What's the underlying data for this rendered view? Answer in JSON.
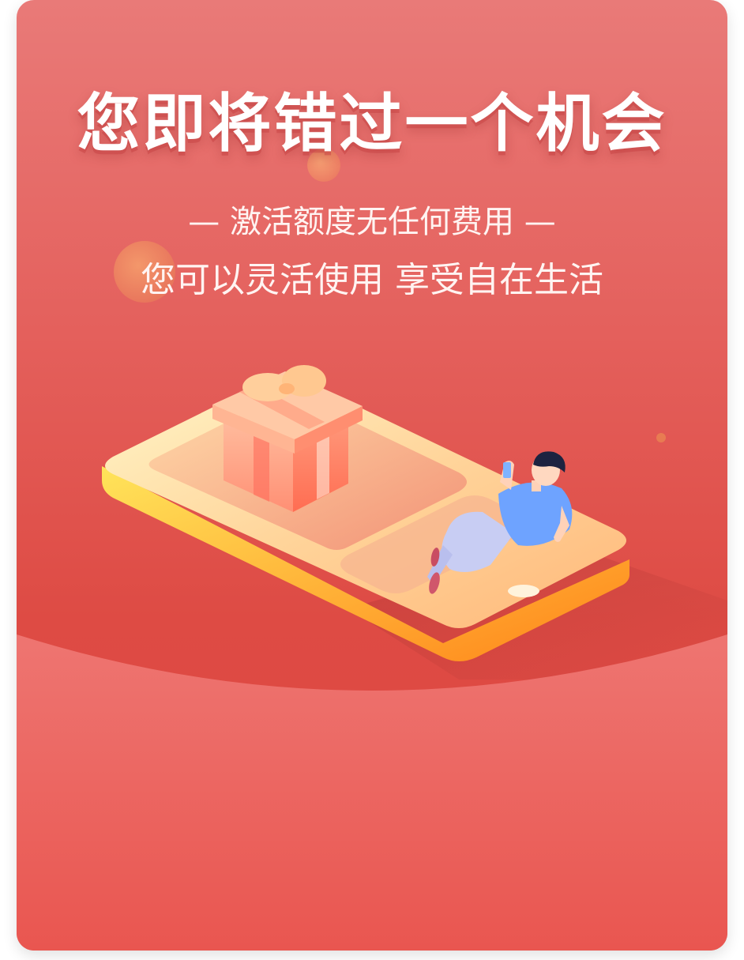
{
  "promo": {
    "headline": "您即将错过一个机会",
    "subline_1": "— 激活额度无任何费用 —",
    "subline_2": "您可以灵活使用 享受自在生活"
  },
  "colors": {
    "background_top": "#e97a78",
    "background_bottom": "#dc4640",
    "accent_orange": "#ff8a1f",
    "shirt_blue": "#6ea3ff"
  },
  "illustration": {
    "icons": [
      "smartphone-icon",
      "gift-box-icon",
      "person-with-phone-icon"
    ]
  }
}
